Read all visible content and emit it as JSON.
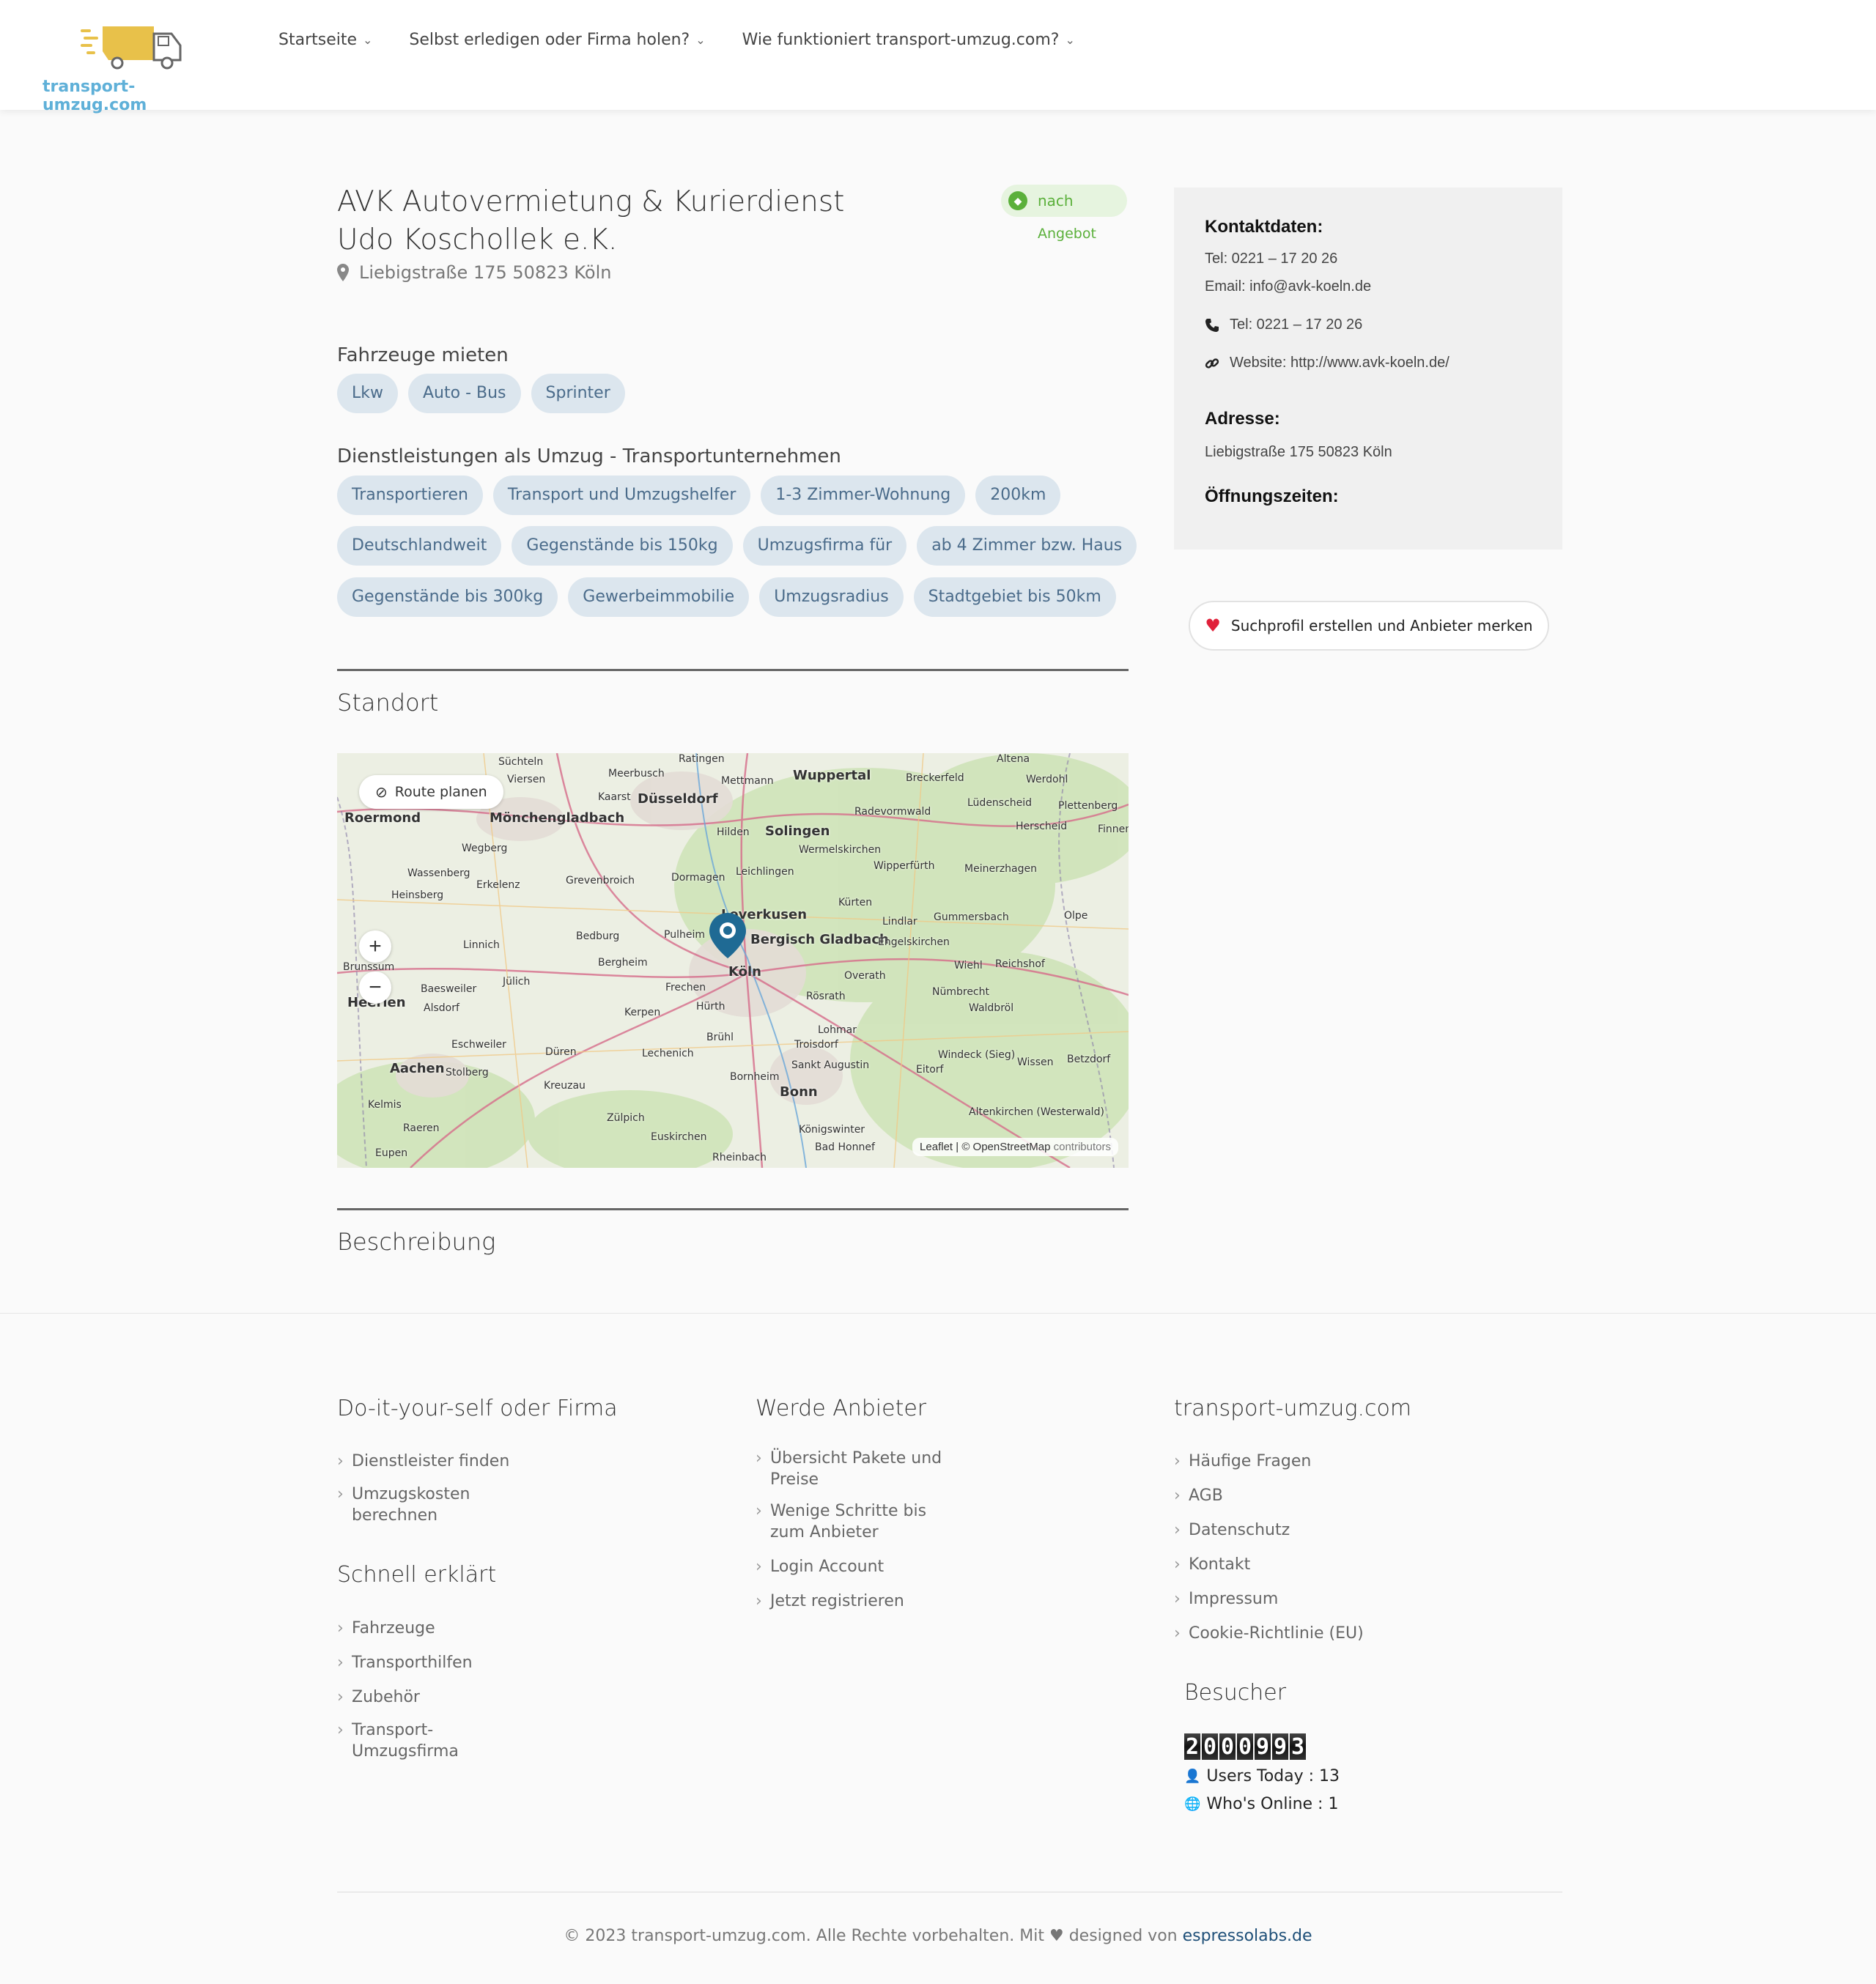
{
  "brand": {
    "logo_text": "transport-umzug.com",
    "accent": "#5fb0d8",
    "truck_color": "#e8c14a"
  },
  "nav": [
    {
      "label": "Startseite"
    },
    {
      "label": "Selbst erledigen oder Firma holen?"
    },
    {
      "label": "Wie funktioniert transport-umzug.com?"
    }
  ],
  "listing": {
    "title": "AVK Autovermietung & Kurierdienst Udo Koschollek e.K.",
    "address": "Liebigstraße 175 50823 Köln",
    "badge_label": "nach",
    "badge_sub": "Angebot"
  },
  "vehicles": {
    "heading": "Fahrzeuge mieten",
    "tags": [
      "Lkw",
      "Auto - Bus",
      "Sprinter"
    ]
  },
  "services": {
    "heading": "Dienstleistungen als Umzug - Transportunternehmen",
    "rows": [
      [
        "Transportieren",
        "Transport und Umzugshelfer",
        "1-3 Zimmer-Wohnung",
        "200km"
      ],
      [
        "Deutschlandweit",
        "Gegenstände bis 150kg",
        "Umzugsfirma für",
        "ab 4 Zimmer bzw. Haus"
      ],
      [
        "Gegenstände bis 300kg",
        "Gewerbeimmobilie",
        "Umzugsradius",
        "Stadtgebiet bis 50km"
      ]
    ]
  },
  "location": {
    "heading": "Standort",
    "route_label": "Route planen",
    "zoom_in": "+",
    "zoom_out": "−",
    "attribution_leaflet": "Leaflet",
    "attribution_sep": " | © ",
    "attribution_osm": "OpenStreetMap",
    "attribution_contrib": " contributors",
    "places": [
      "Süchteln",
      "Meerbusch",
      "Ratingen",
      "Wuppertal",
      "Breckerfeld",
      "Altena",
      "Werdohl",
      "Viersen",
      "Kaarst",
      "Düsseldorf",
      "Mettmann",
      "Lüdenscheid",
      "Plettenberg",
      "Roermond",
      "Mönchengladbach",
      "Hilden",
      "Solingen",
      "Radevormwald",
      "Herscheid",
      "Finnentrop",
      "Wegberg",
      "Wermelskirchen",
      "Wassenberg",
      "Erkelenz",
      "Grevenbroich",
      "Dormagen",
      "Leichlingen",
      "Wipperfürth",
      "Meinerzhagen",
      "Heinsberg",
      "Leverkusen",
      "Kürten",
      "Lindlar",
      "Gummersbach",
      "Olpe",
      "Linnich",
      "Bedburg",
      "Pulheim",
      "Bergisch Gladbach",
      "Engelskirchen",
      "Brunssum",
      "Bergheim",
      "Köln",
      "Wiehl",
      "Reichshof",
      "Heerlen",
      "Baesweiler",
      "Jülich",
      "Frechen",
      "Overath",
      "Alsdorf",
      "Kerpen",
      "Hürth",
      "Rösrath",
      "Nümbrecht",
      "Waldbröl",
      "Eschweiler",
      "Düren",
      "Lechenich",
      "Brühl",
      "Lohmar",
      "Troisdorf",
      "Windeck (Sieg)",
      "Wissen",
      "Betzdorf",
      "Aachen",
      "Stolberg",
      "Bornheim",
      "Sankt Augustin",
      "Eitorf",
      "Kreuzau",
      "Bonn",
      "Kelmis",
      "Zülpich",
      "Altenkirchen (Westerwald)",
      "Raeren",
      "Euskirchen",
      "Königswinter",
      "Eupen",
      "Bad Honnef",
      "Rheinbach"
    ]
  },
  "description": {
    "heading": "Beschreibung"
  },
  "sidebar": {
    "contact_heading": "Kontaktdaten:",
    "phone_line": "Tel: 0221 – 17 20 26",
    "email_line": "Email: info@avk-koeln.de",
    "phone_link": "Tel: 0221 – 17 20 26",
    "website_link": "Website: http://www.avk-koeln.de/",
    "address_heading": "Adresse:",
    "address": "Liebigstraße 175 50823 Köln",
    "hours_heading": "Öffnungszeiten:",
    "favorite_button": "Suchprofil erstellen und Anbieter merken"
  },
  "footer": {
    "col1": {
      "heading": "Do-it-your-self oder Firma",
      "links": [
        "Dienstleister finden",
        "Umzugskosten berechnen"
      ]
    },
    "col1b": {
      "heading": "Schnell erklärt",
      "links": [
        "Fahrzeuge",
        "Transporthilfen",
        "Zubehör",
        "Transport-Umzugsfirma"
      ]
    },
    "col2": {
      "heading": "Werde Anbieter",
      "links": [
        "Übersicht Pakete und Preise",
        "Wenige Schritte bis zum Anbieter",
        "Login Account",
        "Jetzt registrieren"
      ]
    },
    "col3": {
      "heading": "transport-umzug.com",
      "links": [
        "Häufige Fragen",
        "AGB",
        "Datenschutz",
        "Kontakt",
        "Impressum",
        "Cookie-Richtlinie (EU)"
      ]
    },
    "visitors": {
      "heading": "Besucher",
      "counter_digits": [
        "2",
        "0",
        "0",
        "0",
        "9",
        "9",
        "3"
      ],
      "users_today": "Users Today : 13",
      "online": "Who's Online : 1"
    },
    "copyright": "© 2023 transport-umzug.com. Alle Rechte vorbehalten. Mit ♥ designed von ",
    "designer": "espressolabs.de"
  }
}
